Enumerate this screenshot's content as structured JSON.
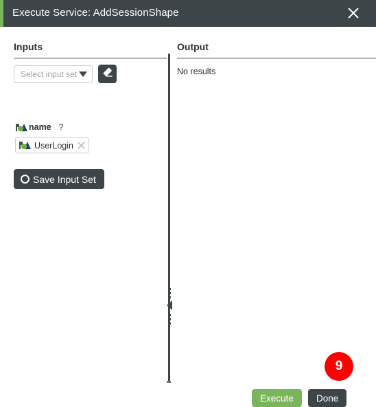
{
  "window": {
    "title": "Execute Service: AddSessionShape",
    "accent_color": "#7ab55c",
    "titlebar_color": "#3d4548",
    "close_icon": "close-icon"
  },
  "inputs_panel": {
    "header": "Inputs",
    "input_set_select": {
      "placeholder": "Select input set",
      "value": "",
      "caret_icon": "chevron-down-icon"
    },
    "clear_button": {
      "icon": "eraser-icon",
      "label": ""
    },
    "fields": [
      {
        "name": "name",
        "icon": "thing-shape-icon",
        "help_icon": "?",
        "chip": {
          "label": "UserLogin",
          "icon": "thing-shape-icon",
          "remove_icon": "close-icon"
        }
      }
    ],
    "save_input_set": {
      "label": "Save Input Set",
      "icon": "circle-icon"
    }
  },
  "output_panel": {
    "header": "Output",
    "empty_message": "No results"
  },
  "divider": {
    "collapse_icon": "caret-left-icon",
    "grip_icon": "grip-dots-icon"
  },
  "footer": {
    "badge": {
      "value": "9",
      "color": "#ff0000"
    },
    "execute_button": {
      "label": "Execute",
      "color": "#7ab55c"
    },
    "done_button": {
      "label": "Done",
      "color": "#3d4548"
    }
  }
}
